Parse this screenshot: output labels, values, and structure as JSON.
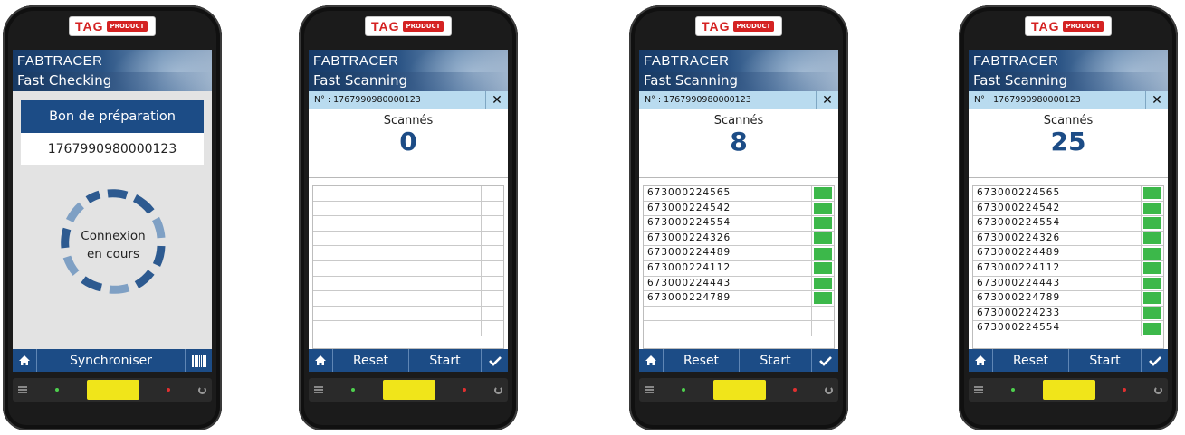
{
  "logo": {
    "tag": "TAG",
    "product": "PRODUCT"
  },
  "screens": [
    {
      "brand": "FABTRACER",
      "subtitle": "Fast Checking",
      "bon_label": "Bon de préparation",
      "bon_value": "1767990980000123",
      "connexion_line1": "Connexion",
      "connexion_line2": "en cours",
      "footer": {
        "home_icon": "home-icon",
        "sync_label": "Synchroniser",
        "barcode_icon": "barcode-icon"
      }
    },
    {
      "brand": "FABTRACER",
      "subtitle": "Fast Scanning",
      "number_label": "N° : 1767990980000123",
      "close_icon": "close-icon",
      "scanned_label": "Scannés",
      "scanned_count": "0",
      "items": [],
      "footer": {
        "reset": "Reset",
        "start": "Start",
        "check_icon": "check-icon"
      }
    },
    {
      "brand": "FABTRACER",
      "subtitle": "Fast Scanning",
      "number_label": "N° : 1767990980000123",
      "close_icon": "close-icon",
      "scanned_label": "Scannés",
      "scanned_count": "8",
      "items": [
        "673000224565",
        "673000224542",
        "673000224554",
        "673000224326",
        "673000224489",
        "673000224112",
        "673000224443",
        "673000224789"
      ],
      "footer": {
        "reset": "Reset",
        "start": "Start",
        "check_icon": "check-icon"
      }
    },
    {
      "brand": "FABTRACER",
      "subtitle": "Fast Scanning",
      "number_label": "N° : 1767990980000123",
      "close_icon": "close-icon",
      "scanned_label": "Scannés",
      "scanned_count": "25",
      "items": [
        "673000224565",
        "673000224542",
        "673000224554",
        "673000224326",
        "673000224489",
        "673000224112",
        "673000224443",
        "673000224789",
        "673000224233",
        "673000224554"
      ],
      "footer": {
        "reset": "Reset",
        "start": "Start",
        "check_icon": "check-icon"
      }
    }
  ],
  "colors": {
    "header_blue": "#1c4c86",
    "status_green": "#3cb84a",
    "number_bar": "#b9dbef",
    "scan_button": "#f0e51a"
  }
}
